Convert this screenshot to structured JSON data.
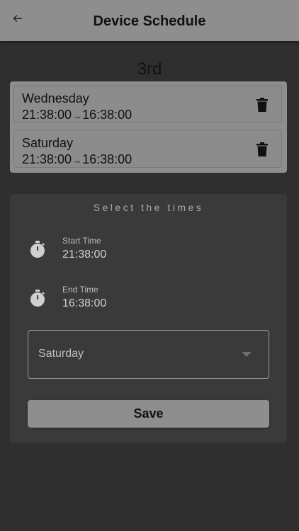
{
  "header": {
    "title": "Device Schedule",
    "back_icon": "arrow-left-icon"
  },
  "section_title": "3rd",
  "schedules": [
    {
      "day": "Wednesday",
      "start": "21:38:00",
      "arrow": "→",
      "end": "16:38:00",
      "action_icon": "trash-icon"
    },
    {
      "day": "Saturday",
      "start": "21:38:00",
      "arrow": "→",
      "end": "16:38:00",
      "action_icon": "trash-icon"
    }
  ],
  "panel": {
    "title": "Select the times",
    "start_time": {
      "label": "Start Time",
      "value": "21:38:00",
      "icon": "timer-icon"
    },
    "end_time": {
      "label": "End Time",
      "value": "16:38:00",
      "icon": "timer-icon"
    },
    "day_select": {
      "selected": "Saturday",
      "icon": "caret-down-icon"
    },
    "save_label": "Save"
  },
  "colors": {
    "background": "#2f2f2f",
    "appbar": "#8e8e8e",
    "panel": "#3a3a3a",
    "button": "#8e8e8e"
  }
}
